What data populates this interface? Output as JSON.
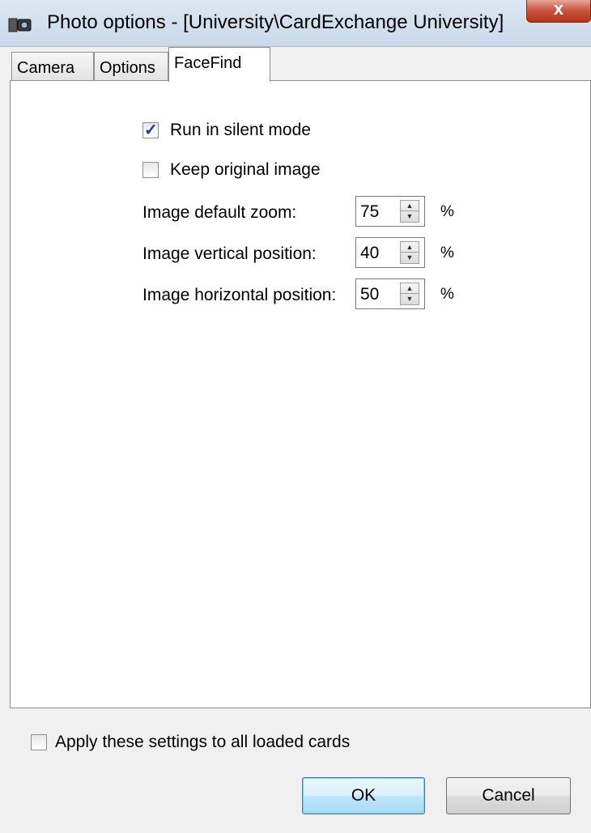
{
  "window": {
    "title": "Photo options - [University\\CardExchange University]",
    "close_symbol": "x"
  },
  "tabs": [
    {
      "label": "Camera",
      "active": false
    },
    {
      "label": "Options",
      "active": false
    },
    {
      "label": "FaceFind",
      "active": true
    }
  ],
  "facefind": {
    "run_silent": {
      "label": "Run in silent mode",
      "checked": true
    },
    "keep_original": {
      "label": "Keep original image",
      "checked": false
    },
    "fields": [
      {
        "label": "Image default zoom:",
        "value": "75",
        "unit": "%"
      },
      {
        "label": "Image vertical position:",
        "value": "40",
        "unit": "%"
      },
      {
        "label": "Image horizontal position:",
        "value": "50",
        "unit": "%"
      }
    ]
  },
  "footer": {
    "apply_all": {
      "label": "Apply these settings to all loaded cards",
      "checked": false
    },
    "ok_label": "OK",
    "cancel_label": "Cancel"
  },
  "icons": {
    "app": "camera-app-icon",
    "close": "close-icon",
    "spin_up": "arrow-up-icon",
    "spin_down": "arrow-down-icon",
    "check": "checkmark-icon"
  },
  "colors": {
    "titlebar": "#c9d9ea",
    "close_button": "#c9523a",
    "default_button": "#bee6fd",
    "checkmark": "#1c3d8a"
  }
}
